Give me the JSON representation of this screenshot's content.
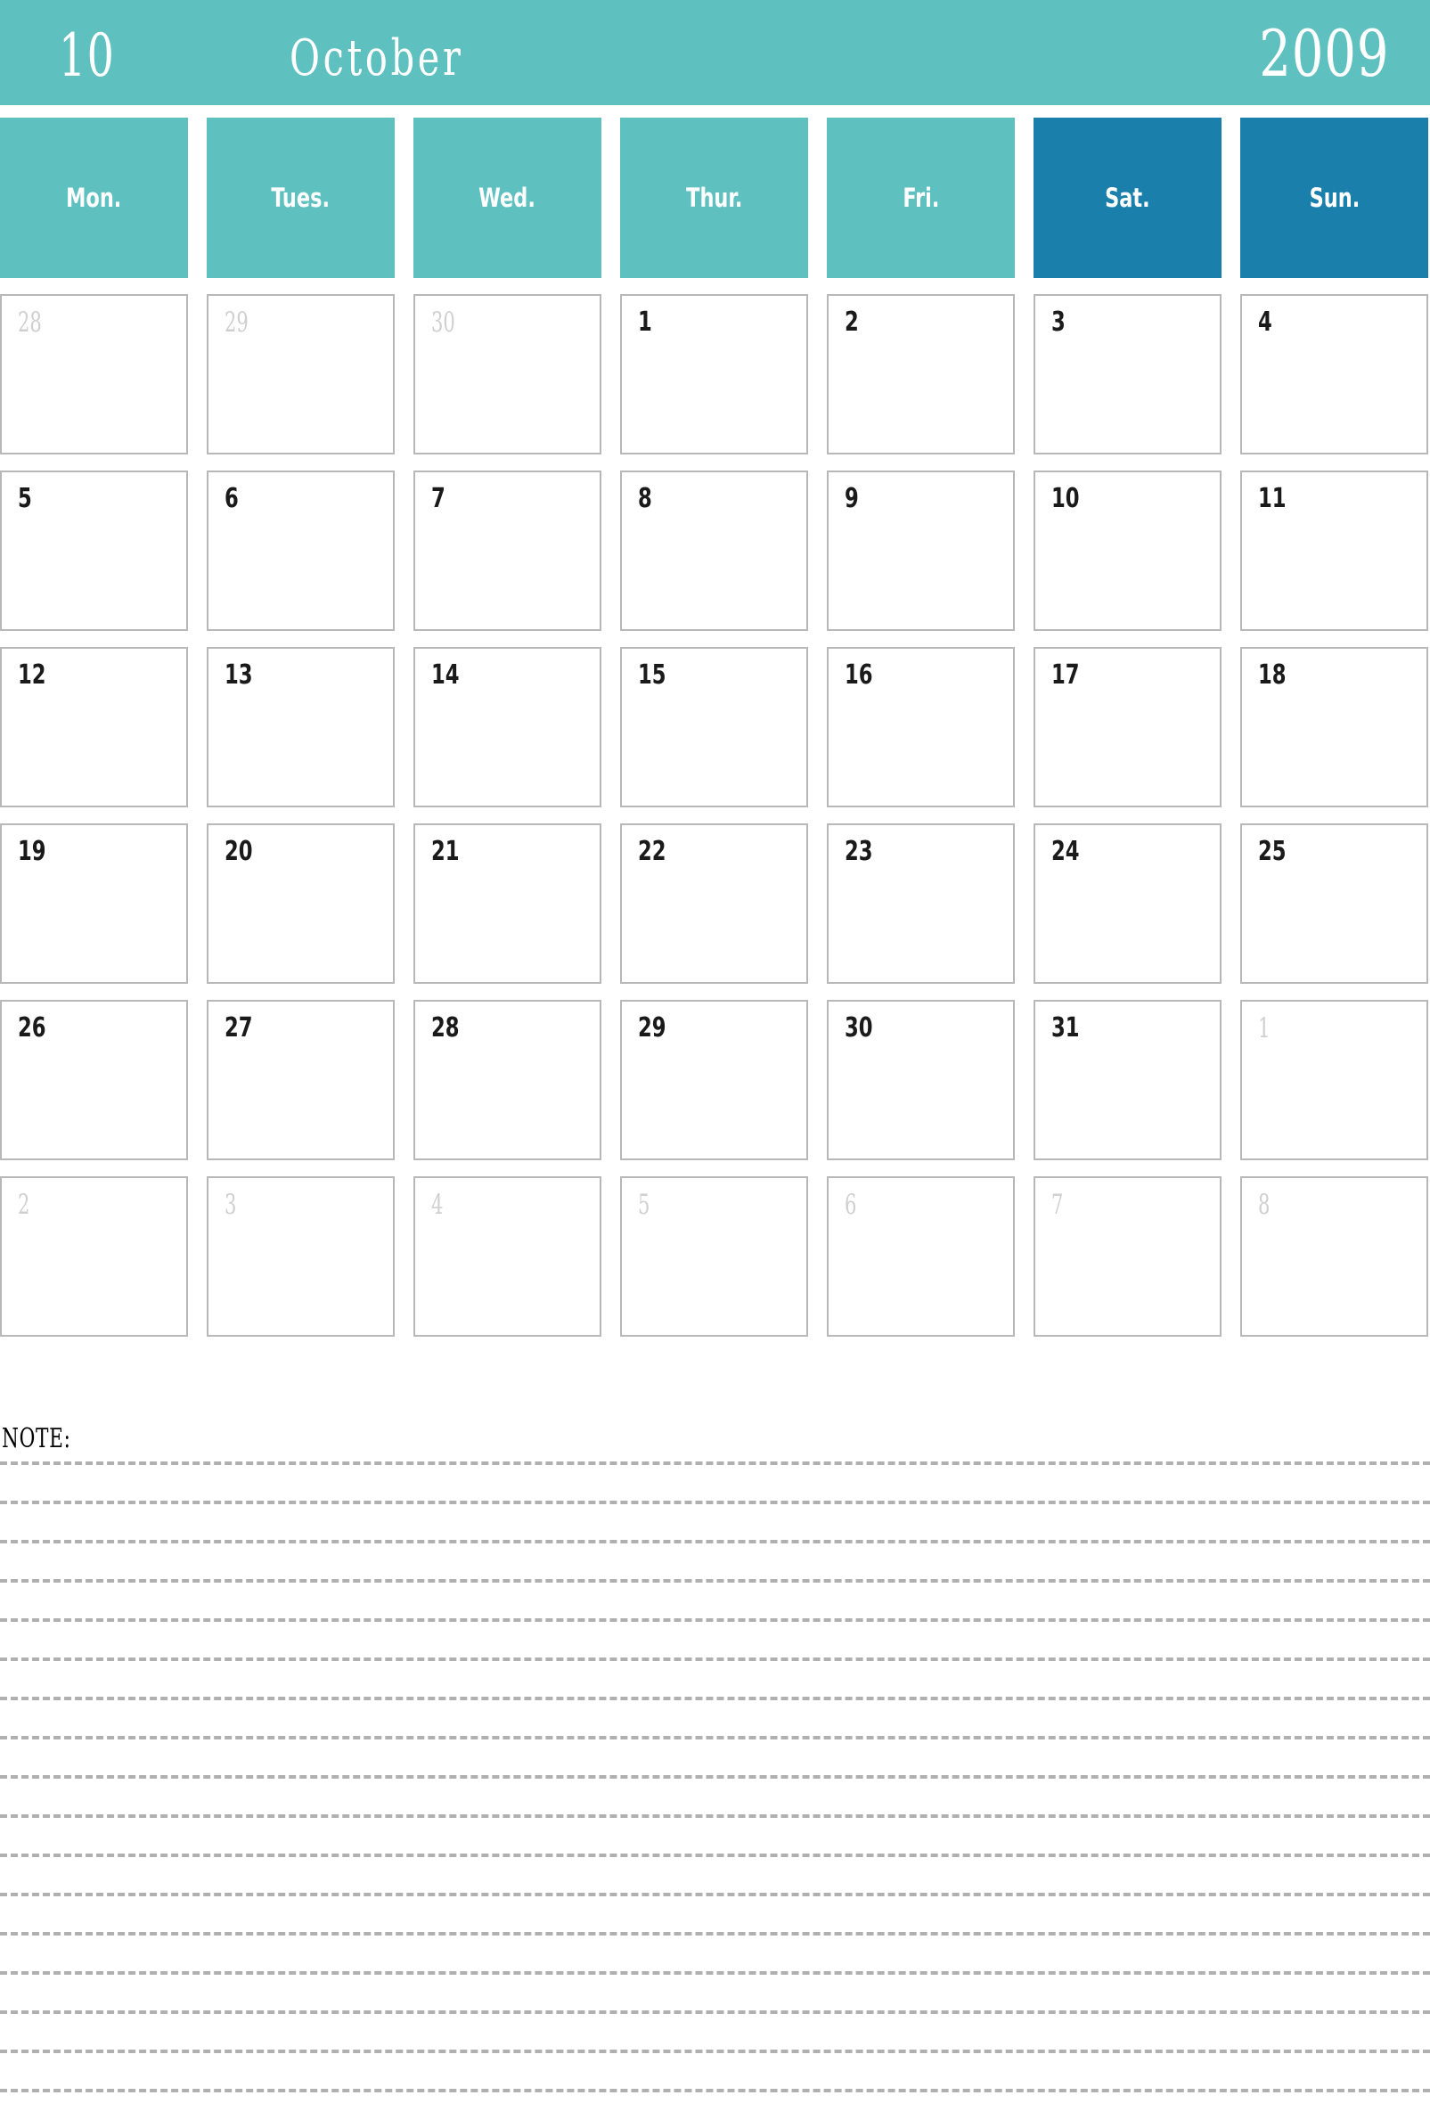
{
  "header": {
    "month_number": "10",
    "month_name": "October",
    "year": "2009",
    "background_color": "#5fc0c0",
    "text_color": "#ffffff"
  },
  "weekdays": [
    {
      "label": "Mon.",
      "weekend": false
    },
    {
      "label": "Tues.",
      "weekend": false
    },
    {
      "label": "Wed.",
      "weekend": false
    },
    {
      "label": "Thur.",
      "weekend": false
    },
    {
      "label": "Fri.",
      "weekend": false
    },
    {
      "label": "Sat.",
      "weekend": true
    },
    {
      "label": "Sun.",
      "weekend": true
    }
  ],
  "colors": {
    "weekday_teal": "#5fc0c0",
    "weekend_blue": "#1b7fab",
    "cell_border": "#b8b8b8",
    "muted_date": "#cfcfcf",
    "active_date": "#1a1a1a",
    "note_line": "#b0b0b0"
  },
  "weeks": [
    [
      {
        "day": "28",
        "muted": true
      },
      {
        "day": "29",
        "muted": true
      },
      {
        "day": "30",
        "muted": true
      },
      {
        "day": "1",
        "muted": false
      },
      {
        "day": "2",
        "muted": false
      },
      {
        "day": "3",
        "muted": false
      },
      {
        "day": "4",
        "muted": false
      }
    ],
    [
      {
        "day": "5",
        "muted": false
      },
      {
        "day": "6",
        "muted": false
      },
      {
        "day": "7",
        "muted": false
      },
      {
        "day": "8",
        "muted": false
      },
      {
        "day": "9",
        "muted": false
      },
      {
        "day": "10",
        "muted": false
      },
      {
        "day": "11",
        "muted": false
      }
    ],
    [
      {
        "day": "12",
        "muted": false
      },
      {
        "day": "13",
        "muted": false
      },
      {
        "day": "14",
        "muted": false
      },
      {
        "day": "15",
        "muted": false
      },
      {
        "day": "16",
        "muted": false
      },
      {
        "day": "17",
        "muted": false
      },
      {
        "day": "18",
        "muted": false
      }
    ],
    [
      {
        "day": "19",
        "muted": false
      },
      {
        "day": "20",
        "muted": false
      },
      {
        "day": "21",
        "muted": false
      },
      {
        "day": "22",
        "muted": false
      },
      {
        "day": "23",
        "muted": false
      },
      {
        "day": "24",
        "muted": false
      },
      {
        "day": "25",
        "muted": false
      }
    ],
    [
      {
        "day": "26",
        "muted": false
      },
      {
        "day": "27",
        "muted": false
      },
      {
        "day": "28",
        "muted": false
      },
      {
        "day": "29",
        "muted": false
      },
      {
        "day": "30",
        "muted": false
      },
      {
        "day": "31",
        "muted": false
      },
      {
        "day": "1",
        "muted": true
      }
    ],
    [
      {
        "day": "2",
        "muted": true
      },
      {
        "day": "3",
        "muted": true
      },
      {
        "day": "4",
        "muted": true
      },
      {
        "day": "5",
        "muted": true
      },
      {
        "day": "6",
        "muted": true
      },
      {
        "day": "7",
        "muted": true
      },
      {
        "day": "8",
        "muted": true
      }
    ]
  ],
  "note": {
    "label": "NOTE:",
    "line_count": 17
  }
}
